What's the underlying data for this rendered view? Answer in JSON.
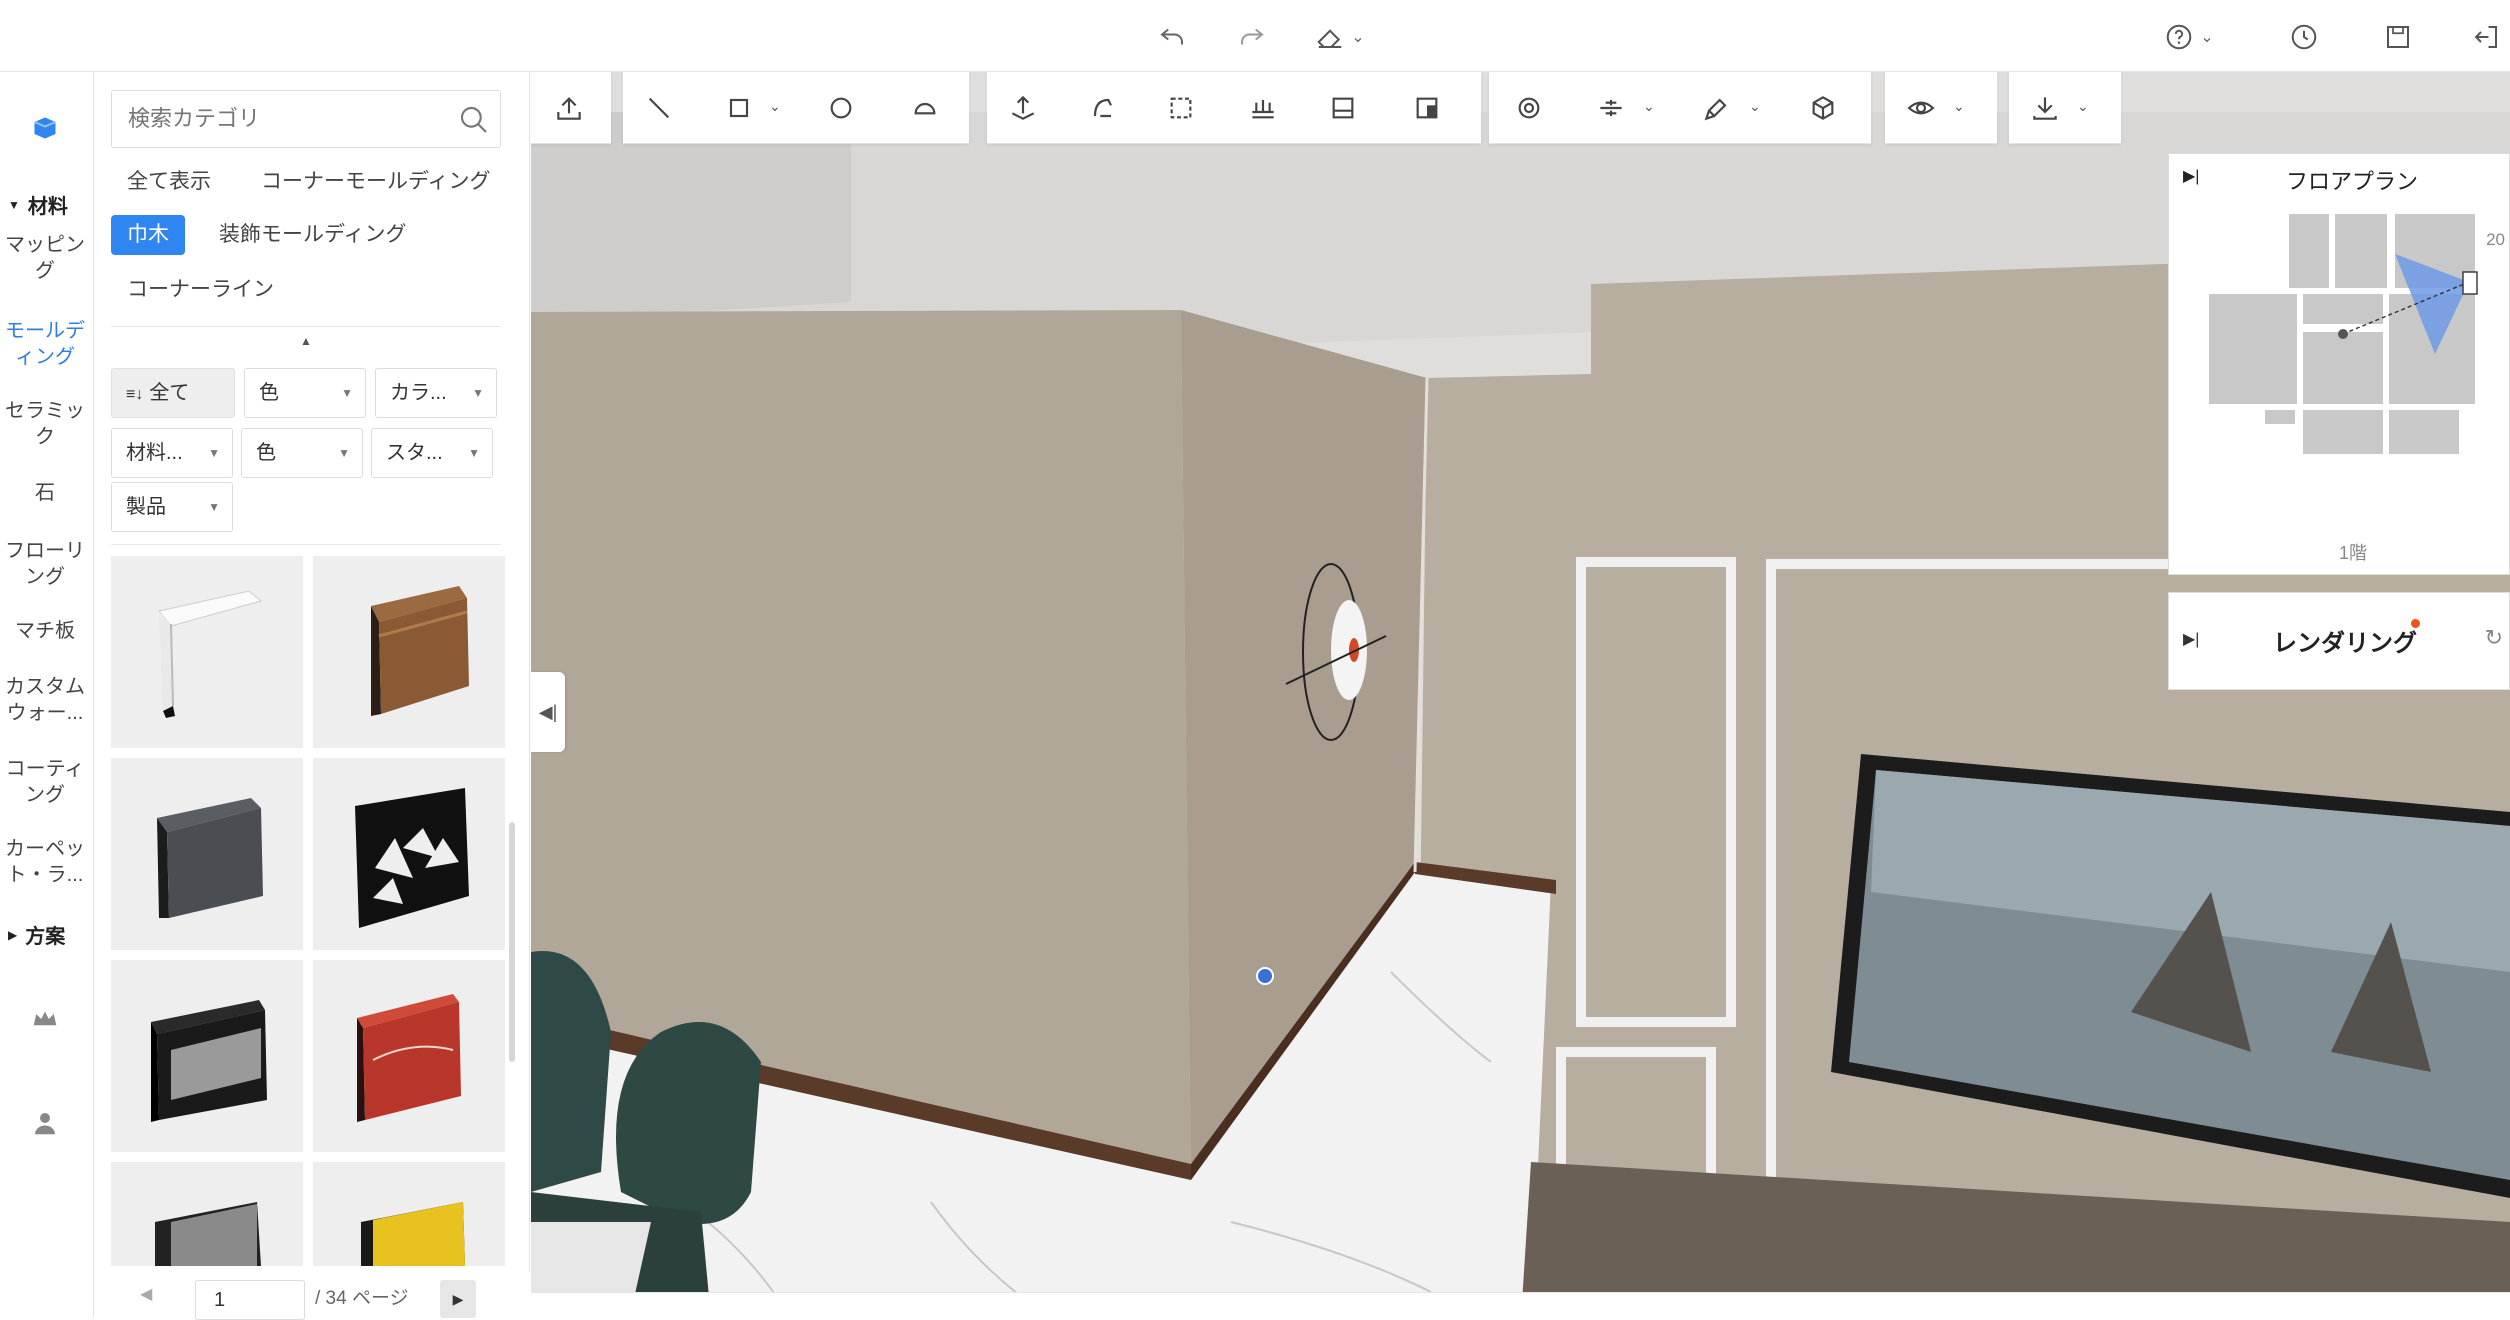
{
  "top_bar": {
    "icons": [
      "undo-icon",
      "redo-icon",
      "eraser-icon",
      "help-icon",
      "history-icon",
      "save-icon",
      "exit-icon"
    ]
  },
  "rail": {
    "section_materials": "材料",
    "items": [
      "マッピング",
      "モールディング",
      "セラミック",
      "石",
      "フローリング",
      "マチ板",
      "カスタムウォー...",
      "コーティング",
      "カーペット・ラ..."
    ],
    "active_item": "モールディング",
    "section_plans": "方案"
  },
  "panel": {
    "search_placeholder": "検索カテゴリ",
    "categories": [
      "全て表示",
      "コーナーモールディング",
      "巾木",
      "装飾モールディング",
      "コーナーライン"
    ],
    "selected_category": "巾木",
    "filters": {
      "sort": "全て",
      "f1": "色",
      "f2": "カラ...",
      "f3": "材料...",
      "f4": "色",
      "f5": "スタ...",
      "f6": "製品"
    },
    "products": [
      {
        "name": "white-baseboard",
        "color": "#f4f4f4"
      },
      {
        "name": "wood-baseboard",
        "color": "#8a5a34"
      },
      {
        "name": "gray-baseboard",
        "color": "#4a4e52"
      },
      {
        "name": "geometric-black-panel",
        "color": "#111111"
      },
      {
        "name": "studded-black-baseboard",
        "color": "#1a1a1a"
      },
      {
        "name": "red-marble-baseboard",
        "color": "#b8362a"
      },
      {
        "name": "black-baseboard",
        "color": "#222222"
      },
      {
        "name": "yellow-baseboard",
        "color": "#e8c21e"
      }
    ],
    "pager": {
      "current": "1",
      "total": "/ 34 ページ"
    }
  },
  "floorplan": {
    "title": "フロアプラン",
    "floor_label": "1階",
    "zoom_label": "20"
  },
  "render": {
    "title": "レンダリング"
  },
  "colors": {
    "accent": "#2f86f0",
    "wall": "#b5ab9c",
    "skirting": "#5a3a28"
  }
}
